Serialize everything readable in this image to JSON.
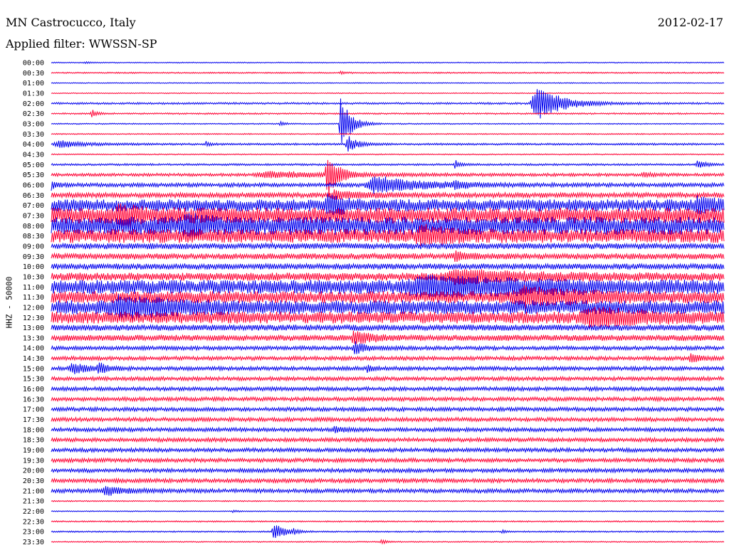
{
  "header": {
    "station": "MN Castrocucco, Italy",
    "filter": "Applied filter: WWSSN-SP",
    "date": "2012-02-17"
  },
  "chart_data": {
    "type": "line",
    "title": "MN Castrocucco, Italy",
    "subtitle": "Applied filter: WWSSN-SP",
    "date": "2012-02-17",
    "ylabel": "HHZ - 50000",
    "colors": [
      "#0000ee",
      "#ff0033"
    ],
    "rows": [
      {
        "time": "00:00",
        "noise": 0.5,
        "events": [
          {
            "pos": 0.05,
            "amp": 1,
            "w": 0.02
          }
        ]
      },
      {
        "time": "00:30",
        "noise": 0.7,
        "events": [
          {
            "pos": 0.43,
            "amp": 2,
            "w": 0.01
          }
        ]
      },
      {
        "time": "01:00",
        "noise": 0.5,
        "events": []
      },
      {
        "time": "01:30",
        "noise": 0.5,
        "events": []
      },
      {
        "time": "02:00",
        "noise": 1,
        "events": [
          {
            "pos": 0.72,
            "amp": 26,
            "w": 0.05
          }
        ]
      },
      {
        "time": "02:30",
        "noise": 0.8,
        "events": [
          {
            "pos": 0.06,
            "amp": 6,
            "w": 0.01
          }
        ]
      },
      {
        "time": "03:00",
        "noise": 0.6,
        "events": [
          {
            "pos": 0.34,
            "amp": 3,
            "w": 0.01
          },
          {
            "pos": 0.43,
            "amp": 40,
            "w": 0.02
          }
        ]
      },
      {
        "time": "03:30",
        "noise": 0.6,
        "events": []
      },
      {
        "time": "04:00",
        "noise": 1,
        "events": [
          {
            "pos": 0.01,
            "amp": 5,
            "w": 0.05
          },
          {
            "pos": 0.23,
            "amp": 3,
            "w": 0.01
          },
          {
            "pos": 0.44,
            "amp": 12,
            "w": 0.02
          }
        ]
      },
      {
        "time": "04:30",
        "noise": 0.6,
        "events": []
      },
      {
        "time": "05:00",
        "noise": 1,
        "events": [
          {
            "pos": 0.6,
            "amp": 6,
            "w": 0.01
          },
          {
            "pos": 0.96,
            "amp": 5,
            "w": 0.02
          }
        ]
      },
      {
        "time": "05:30",
        "noise": 1.5,
        "events": [
          {
            "pos": 0.32,
            "amp": 4,
            "w": 0.15
          },
          {
            "pos": 0.41,
            "amp": 35,
            "w": 0.02
          },
          {
            "pos": 0.88,
            "amp": 3,
            "w": 0.02
          }
        ]
      },
      {
        "time": "06:00",
        "noise": 2,
        "events": [
          {
            "pos": 0.0,
            "amp": 6,
            "w": 0.01
          },
          {
            "pos": 0.48,
            "amp": 12,
            "w": 0.09
          },
          {
            "pos": 0.6,
            "amp": 5,
            "w": 0.02
          }
        ]
      },
      {
        "time": "06:30",
        "noise": 2.5,
        "events": [
          {
            "pos": 0.42,
            "amp": 6,
            "w": 0.05
          }
        ]
      },
      {
        "time": "07:00",
        "noise": 6,
        "events": [
          {
            "pos": 0.41,
            "amp": 14,
            "w": 0.03
          },
          {
            "pos": 0.96,
            "amp": 9,
            "w": 0.03
          }
        ]
      },
      {
        "time": "07:30",
        "noise": 8,
        "events": [
          {
            "pos": 0.1,
            "amp": 12,
            "w": 0.04
          }
        ]
      },
      {
        "time": "08:00",
        "noise": 9,
        "events": [
          {
            "pos": 0.2,
            "amp": 12,
            "w": 0.04
          }
        ]
      },
      {
        "time": "08:30",
        "noise": 7,
        "events": [
          {
            "pos": 0.55,
            "amp": 10,
            "w": 0.05
          }
        ]
      },
      {
        "time": "09:00",
        "noise": 3,
        "events": []
      },
      {
        "time": "09:30",
        "noise": 3,
        "events": [
          {
            "pos": 0.6,
            "amp": 7,
            "w": 0.02
          }
        ]
      },
      {
        "time": "10:00",
        "noise": 3,
        "events": []
      },
      {
        "time": "10:30",
        "noise": 4,
        "events": [
          {
            "pos": 0.6,
            "amp": 8,
            "w": 0.15
          }
        ]
      },
      {
        "time": "11:00",
        "noise": 7,
        "events": [
          {
            "pos": 0.55,
            "amp": 11,
            "w": 0.2
          }
        ]
      },
      {
        "time": "11:30",
        "noise": 6,
        "events": [
          {
            "pos": 0.7,
            "amp": 10,
            "w": 0.1
          }
        ]
      },
      {
        "time": "12:00",
        "noise": 7,
        "events": [
          {
            "pos": 0.1,
            "amp": 12,
            "w": 0.1
          }
        ]
      },
      {
        "time": "12:30",
        "noise": 6,
        "events": [
          {
            "pos": 0.8,
            "amp": 11,
            "w": 0.1
          }
        ]
      },
      {
        "time": "13:00",
        "noise": 3,
        "events": []
      },
      {
        "time": "13:30",
        "noise": 3,
        "events": [
          {
            "pos": 0.45,
            "amp": 10,
            "w": 0.03
          }
        ]
      },
      {
        "time": "14:00",
        "noise": 2,
        "events": [
          {
            "pos": 0.45,
            "amp": 9,
            "w": 0.02
          }
        ]
      },
      {
        "time": "14:30",
        "noise": 2,
        "events": [
          {
            "pos": 0.95,
            "amp": 6,
            "w": 0.02
          }
        ]
      },
      {
        "time": "15:00",
        "noise": 2,
        "events": [
          {
            "pos": 0.03,
            "amp": 8,
            "w": 0.03
          },
          {
            "pos": 0.07,
            "amp": 7,
            "w": 0.02
          },
          {
            "pos": 0.47,
            "amp": 5,
            "w": 0.01
          }
        ]
      },
      {
        "time": "15:30",
        "noise": 2,
        "events": []
      },
      {
        "time": "16:00",
        "noise": 2,
        "events": []
      },
      {
        "time": "16:30",
        "noise": 2,
        "events": []
      },
      {
        "time": "17:00",
        "noise": 2,
        "events": []
      },
      {
        "time": "17:30",
        "noise": 2,
        "events": []
      },
      {
        "time": "18:00",
        "noise": 2,
        "events": [
          {
            "pos": 0.42,
            "amp": 4,
            "w": 0.02
          }
        ]
      },
      {
        "time": "18:30",
        "noise": 2,
        "events": []
      },
      {
        "time": "19:00",
        "noise": 2,
        "events": []
      },
      {
        "time": "19:30",
        "noise": 2,
        "events": []
      },
      {
        "time": "20:00",
        "noise": 2,
        "events": []
      },
      {
        "time": "20:30",
        "noise": 2,
        "events": []
      },
      {
        "time": "21:00",
        "noise": 2,
        "events": [
          {
            "pos": 0.08,
            "amp": 6,
            "w": 0.04
          }
        ]
      },
      {
        "time": "21:30",
        "noise": 0.6,
        "events": []
      },
      {
        "time": "22:00",
        "noise": 0.5,
        "events": [
          {
            "pos": 0.27,
            "amp": 2,
            "w": 0.01
          }
        ]
      },
      {
        "time": "22:30",
        "noise": 0.7,
        "events": []
      },
      {
        "time": "23:00",
        "noise": 0.7,
        "events": [
          {
            "pos": 0.33,
            "amp": 15,
            "w": 0.02
          },
          {
            "pos": 0.36,
            "amp": 3,
            "w": 0.01
          },
          {
            "pos": 0.67,
            "amp": 2,
            "w": 0.01
          }
        ]
      },
      {
        "time": "23:30",
        "noise": 0.6,
        "events": [
          {
            "pos": 0.49,
            "amp": 4,
            "w": 0.01
          }
        ]
      }
    ]
  }
}
